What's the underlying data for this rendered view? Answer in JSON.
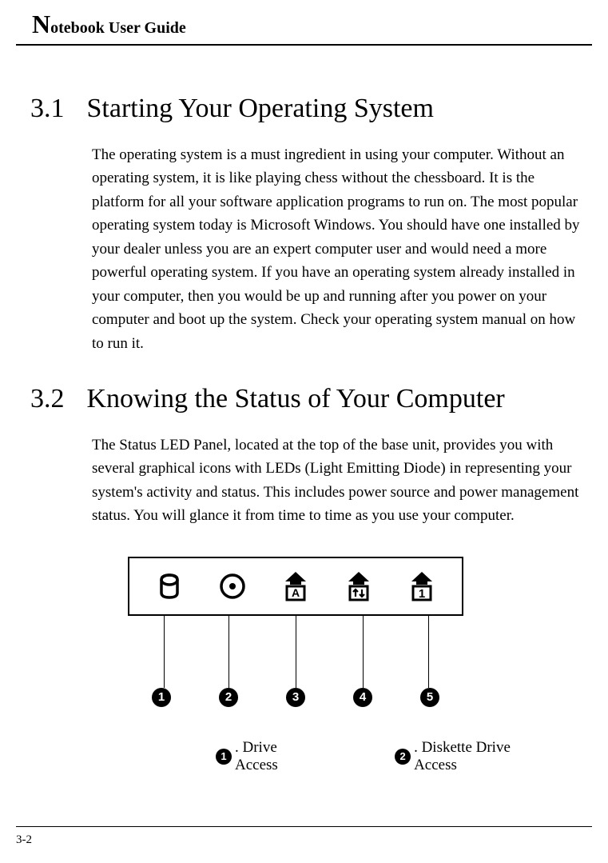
{
  "header": {
    "title_first": "N",
    "title_rest": "otebook User Guide"
  },
  "section1": {
    "number": "3.1",
    "title": "Starting Your Operating System",
    "body": "The operating system is a must ingredient in using your computer. Without an operating system, it is like playing chess without the chessboard. It is the platform for all your software application programs to run on. The most popular operating system today is Microsoft Windows. You should have one installed by your dealer unless you are an expert computer user and would need a more powerful operating system. If you have an operating system already installed in your computer, then you would be up and running after you power on your computer and boot up the system. Check your operating system manual on how to run it."
  },
  "section2": {
    "number": "3.2",
    "title": "Knowing the Status of Your Computer",
    "body": "The Status LED Panel, located at the top of the base unit, provides you with several graphical icons with LEDs (Light Emitting Diode) in representing your system's activity and status. This includes power source and power management status. You will glance it from time to time as you use your computer."
  },
  "callouts": {
    "n1": "1",
    "n2": "2",
    "n3": "3",
    "n4": "4",
    "n5": "5"
  },
  "legend": {
    "item1_num": "1",
    "item1_text": ". Drive Access",
    "item2_num": "2",
    "item2_text": ". Diskette Drive Access"
  },
  "footer": {
    "page": "3-2"
  }
}
